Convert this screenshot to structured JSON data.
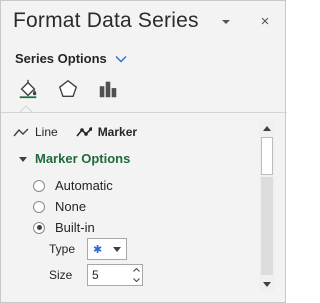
{
  "pane": {
    "title": "Format Data Series",
    "pin_icon": "pin-dropdown-icon",
    "close_icon": "close-icon",
    "close_glyph": "×",
    "series_options_label": "Series Options"
  },
  "icon_tabs": [
    {
      "name": "fill-line-icon"
    },
    {
      "name": "effects-pentagon-icon"
    },
    {
      "name": "series-options-bars-icon"
    }
  ],
  "subtabs": {
    "line_label": "Line",
    "marker_label": "Marker",
    "active": "Marker"
  },
  "marker_options": {
    "heading": "Marker Options",
    "options": [
      {
        "label": "Automatic",
        "checked": false
      },
      {
        "label": "None",
        "checked": false
      },
      {
        "label": "Built-in",
        "checked": true
      }
    ],
    "type_label": "Type",
    "type_value_glyph": "✱",
    "size_label": "Size",
    "size_value": "5"
  },
  "colors": {
    "accent_green": "#1f6b3b",
    "accent_blue": "#2e6bd0",
    "pane_bg": "#f3f3f3"
  }
}
